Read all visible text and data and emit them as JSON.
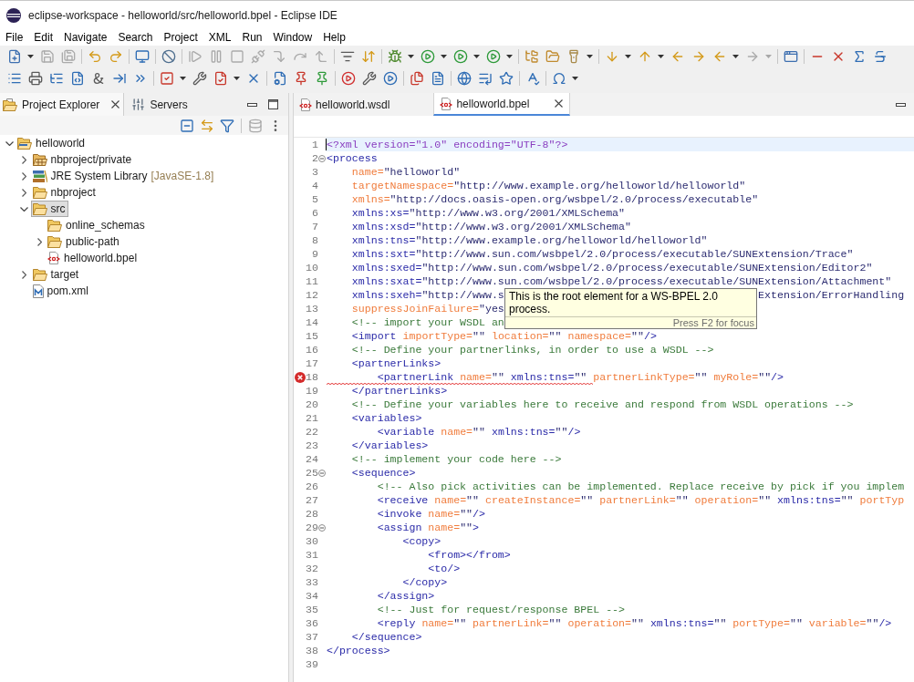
{
  "window": {
    "title": "eclipse-workspace - helloworld/src/helloworld.bpel - Eclipse IDE"
  },
  "menu": [
    "File",
    "Edit",
    "Navigate",
    "Search",
    "Project",
    "XML",
    "Run",
    "Window",
    "Help"
  ],
  "toolbar": [
    {
      "groups": [
        {
          "buttons": [
            {
              "disabled": false,
              "dropdown": true
            },
            {
              "disabled": true,
              "dropdown": false
            },
            {
              "disabled": true,
              "dropdown": false
            }
          ]
        },
        {
          "buttons": [
            {
              "disabled": false,
              "dropdown": false
            },
            {
              "disabled": false,
              "dropdown": false
            }
          ]
        },
        {
          "buttons": [
            {
              "disabled": false,
              "dropdown": false
            }
          ]
        },
        {
          "buttons": [
            {
              "disabled": false,
              "dropdown": false
            }
          ]
        },
        {
          "buttons": [
            {
              "disabled": true,
              "dropdown": false
            },
            {
              "disabled": true,
              "dropdown": false
            },
            {
              "disabled": true,
              "dropdown": false
            },
            {
              "disabled": true,
              "dropdown": false
            },
            {
              "disabled": true,
              "dropdown": false
            },
            {
              "disabled": true,
              "dropdown": false
            },
            {
              "disabled": true,
              "dropdown": false
            }
          ]
        },
        {
          "buttons": [
            {
              "disabled": false,
              "dropdown": false
            },
            {
              "disabled": false,
              "dropdown": false
            }
          ]
        },
        {
          "buttons": [
            {
              "disabled": false,
              "dropdown": true
            },
            {
              "disabled": false,
              "dropdown": true
            },
            {
              "disabled": false,
              "dropdown": true
            },
            {
              "disabled": false,
              "dropdown": true
            }
          ]
        },
        {
          "buttons": [
            {
              "disabled": false,
              "dropdown": false
            },
            {
              "disabled": false,
              "dropdown": false
            },
            {
              "disabled": false,
              "dropdown": true
            }
          ]
        },
        {
          "buttons": [
            {
              "disabled": false,
              "dropdown": true
            },
            {
              "disabled": false,
              "dropdown": true
            },
            {
              "disabled": false,
              "dropdown": false
            },
            {
              "disabled": false,
              "dropdown": false
            },
            {
              "disabled": false,
              "dropdown": true
            },
            {
              "disabled": true,
              "dropdown": true
            }
          ]
        },
        {
          "buttons": [
            {
              "disabled": false,
              "dropdown": false
            }
          ]
        },
        {
          "buttons": [
            {
              "disabled": false,
              "dropdown": false
            },
            {
              "disabled": false,
              "dropdown": false
            },
            {
              "disabled": false,
              "dropdown": false
            },
            {
              "disabled": false,
              "dropdown": false
            }
          ]
        }
      ]
    },
    {
      "groups": [
        {
          "buttons": [
            {
              "disabled": false,
              "dropdown": false
            },
            {
              "disabled": false,
              "dropdown": false
            },
            {
              "disabled": false,
              "dropdown": false
            },
            {
              "disabled": false,
              "dropdown": false
            },
            {
              "disabled": false,
              "dropdown": false
            },
            {
              "disabled": false,
              "dropdown": false
            },
            {
              "disabled": false,
              "dropdown": false
            }
          ]
        },
        {
          "buttons": [
            {
              "disabled": false,
              "dropdown": true
            },
            {
              "disabled": false,
              "dropdown": false
            },
            {
              "disabled": false,
              "dropdown": true
            },
            {
              "disabled": false,
              "dropdown": false
            }
          ]
        },
        {
          "buttons": [
            {
              "disabled": false,
              "dropdown": false
            },
            {
              "disabled": false,
              "dropdown": false
            },
            {
              "disabled": false,
              "dropdown": false
            }
          ]
        },
        {
          "buttons": [
            {
              "disabled": false,
              "dropdown": false
            },
            {
              "disabled": false,
              "dropdown": false
            },
            {
              "disabled": false,
              "dropdown": false
            }
          ]
        },
        {
          "buttons": [
            {
              "disabled": false,
              "dropdown": false
            },
            {
              "disabled": false,
              "dropdown": false
            }
          ]
        },
        {
          "buttons": [
            {
              "disabled": false,
              "dropdown": false
            },
            {
              "disabled": false,
              "dropdown": false
            },
            {
              "disabled": false,
              "dropdown": false
            }
          ]
        },
        {
          "buttons": [
            {
              "disabled": false,
              "dropdown": false
            }
          ]
        },
        {
          "buttons": [
            {
              "disabled": false,
              "dropdown": true
            }
          ]
        }
      ]
    }
  ],
  "project_explorer": {
    "tabs": [
      {
        "label": "Project Explorer",
        "selected": true
      },
      {
        "label": "Servers",
        "selected": false
      }
    ],
    "toolbar": [
      {
        "disabled": false
      },
      {
        "disabled": false
      },
      {
        "disabled": false
      },
      {
        "disabled": true
      },
      {
        "disabled": false
      }
    ],
    "tree": [
      {
        "label": "helloworld",
        "kind": "project",
        "expanded": true,
        "selected": false,
        "children": [
          {
            "label": "nbproject/private",
            "kind": "package",
            "expanded": false,
            "selected": false
          },
          {
            "label": "JRE System Library",
            "decoration": "[JavaSE-1.8]",
            "kind": "library",
            "expanded": false,
            "selected": false
          },
          {
            "label": "nbproject",
            "kind": "folder",
            "expanded": false,
            "selected": false
          },
          {
            "label": "src",
            "kind": "folder",
            "expanded": true,
            "selected": true,
            "children": [
              {
                "label": "online_schemas",
                "kind": "folder",
                "selected": false
              },
              {
                "label": "public-path",
                "kind": "folder",
                "expanded": false,
                "selected": false
              },
              {
                "label": "helloworld.bpel",
                "kind": "xml-file",
                "selected": false
              }
            ]
          },
          {
            "label": "target",
            "kind": "folder",
            "expanded": false,
            "selected": false
          },
          {
            "label": "pom.xml",
            "kind": "pom-file",
            "selected": false
          }
        ]
      }
    ]
  },
  "editor": {
    "tabs": [
      {
        "label": "helloworld.wsdl",
        "selected": false
      },
      {
        "label": "helloworld.bpel",
        "selected": true
      }
    ],
    "lines": [
      {
        "number": "1",
        "current": true,
        "error": false,
        "tokens": [
          {
            "kind": "pi",
            "text": "<?xml version=\"1.0\" encoding=\"UTF-8\"?>"
          }
        ]
      },
      {
        "number": "2",
        "current": false,
        "error": false,
        "expanded": true,
        "tokens": [
          {
            "kind": "tag",
            "text": "<process"
          }
        ]
      },
      {
        "number": "3",
        "current": false,
        "error": false,
        "tokens": [
          {
            "kind": "attr",
            "text": "    name="
          },
          {
            "kind": "value",
            "text": "\"helloworld\""
          }
        ]
      },
      {
        "number": "4",
        "current": false,
        "error": false,
        "tokens": [
          {
            "kind": "attr",
            "text": "    targetNamespace="
          },
          {
            "kind": "value",
            "text": "\"http://www.example.org/helloworld/helloworld\""
          }
        ]
      },
      {
        "number": "5",
        "current": false,
        "error": false,
        "tokens": [
          {
            "kind": "attr",
            "text": "    xmlns="
          },
          {
            "kind": "value",
            "text": "\"http://docs.oasis-open.org/wsbpel/2.0/process/executable\""
          }
        ]
      },
      {
        "number": "6",
        "current": false,
        "error": false,
        "tokens": [
          {
            "kind": "ns",
            "text": "    xmlns:xs="
          },
          {
            "kind": "value",
            "text": "\"http://www.w3.org/2001/XMLSchema\""
          }
        ]
      },
      {
        "number": "7",
        "current": false,
        "error": false,
        "tokens": [
          {
            "kind": "ns",
            "text": "    xmlns:xsd="
          },
          {
            "kind": "value",
            "text": "\"http://www.w3.org/2001/XMLSchema\""
          }
        ]
      },
      {
        "number": "8",
        "current": false,
        "error": false,
        "tokens": [
          {
            "kind": "ns",
            "text": "    xmlns:tns="
          },
          {
            "kind": "value",
            "text": "\"http://www.example.org/helloworld/helloworld\""
          }
        ]
      },
      {
        "number": "9",
        "current": false,
        "error": false,
        "tokens": [
          {
            "kind": "ns",
            "text": "    xmlns:sxt="
          },
          {
            "kind": "value",
            "text": "\"http://www.sun.com/wsbpel/2.0/process/executable/SUNExtension/Trace\""
          }
        ]
      },
      {
        "number": "10",
        "current": false,
        "error": false,
        "tokens": [
          {
            "kind": "ns",
            "text": "    xmlns:sxed="
          },
          {
            "kind": "value",
            "text": "\"http://www.sun.com/wsbpel/2.0/process/executable/SUNExtension/Editor2\""
          }
        ]
      },
      {
        "number": "11",
        "current": false,
        "error": false,
        "tokens": [
          {
            "kind": "ns",
            "text": "    xmlns:sxat="
          },
          {
            "kind": "value",
            "text": "\"http://www.sun.com/wsbpel/2.0/process/executable/SUNExtension/Attachment\""
          }
        ]
      },
      {
        "number": "12",
        "current": false,
        "error": false,
        "tokens": [
          {
            "kind": "ns",
            "text": "    xmlns:sxeh="
          },
          {
            "kind": "value",
            "text": "\"http://www.s"
          }
        ],
        "tokens_after_tooltip": [
          {
            "kind": "value",
            "text": "Extension/ErrorHandling"
          }
        ]
      },
      {
        "number": "13",
        "current": false,
        "error": false,
        "tokens": [
          {
            "kind": "attr",
            "text": "    suppressJoinFailure="
          },
          {
            "kind": "value",
            "text": "\"yes"
          }
        ]
      },
      {
        "number": "14",
        "current": false,
        "error": false,
        "tokens": [
          {
            "kind": "comment",
            "text": "    <!-- import your WSDL an"
          }
        ]
      },
      {
        "number": "15",
        "current": false,
        "error": false,
        "tokens": [
          {
            "kind": "tag",
            "text": "    <import"
          },
          {
            "kind": "attr",
            "text": " importType="
          },
          {
            "kind": "value",
            "text": "\"\""
          },
          {
            "kind": "attr",
            "text": " location="
          },
          {
            "kind": "value",
            "text": "\"\""
          },
          {
            "kind": "attr",
            "text": " namespace="
          },
          {
            "kind": "value",
            "text": "\"\""
          },
          {
            "kind": "tag",
            "text": "/>"
          }
        ]
      },
      {
        "number": "16",
        "current": false,
        "error": false,
        "tokens": [
          {
            "kind": "comment",
            "text": "    <!-- Define your partnerlinks, in order to use a WSDL -->"
          }
        ]
      },
      {
        "number": "17",
        "current": false,
        "error": false,
        "tokens": [
          {
            "kind": "tag",
            "text": "    <partnerLinks>"
          }
        ]
      },
      {
        "number": "18",
        "current": false,
        "error": true,
        "tokens": [
          {
            "kind": "tag",
            "text": "        <partnerLink"
          },
          {
            "kind": "attr",
            "text": " name="
          },
          {
            "kind": "value",
            "text": "\"\""
          },
          {
            "kind": "ns",
            "text": " xmlns:tns="
          },
          {
            "kind": "value",
            "text": "\"\""
          },
          {
            "kind": "attr",
            "text": " partnerLinkType="
          },
          {
            "kind": "value",
            "text": "\"\""
          },
          {
            "kind": "attr",
            "text": " myRole="
          },
          {
            "kind": "value",
            "text": "\"\""
          },
          {
            "kind": "tag",
            "text": "/>"
          }
        ]
      },
      {
        "number": "19",
        "current": false,
        "error": false,
        "tokens": [
          {
            "kind": "tag",
            "text": "    </partnerLinks>"
          }
        ]
      },
      {
        "number": "20",
        "current": false,
        "error": false,
        "tokens": [
          {
            "kind": "comment",
            "text": "    <!-- Define your variables here to receive and respond from WSDL operations -->"
          }
        ]
      },
      {
        "number": "21",
        "current": false,
        "error": false,
        "tokens": [
          {
            "kind": "tag",
            "text": "    <variables>"
          }
        ]
      },
      {
        "number": "22",
        "current": false,
        "error": false,
        "tokens": [
          {
            "kind": "tag",
            "text": "        <variable"
          },
          {
            "kind": "attr",
            "text": " name="
          },
          {
            "kind": "value",
            "text": "\"\""
          },
          {
            "kind": "ns",
            "text": " xmlns:tns="
          },
          {
            "kind": "value",
            "text": "\"\""
          },
          {
            "kind": "tag",
            "text": "/>"
          }
        ]
      },
      {
        "number": "23",
        "current": false,
        "error": false,
        "tokens": [
          {
            "kind": "tag",
            "text": "    </variables>"
          }
        ]
      },
      {
        "number": "24",
        "current": false,
        "error": false,
        "tokens": [
          {
            "kind": "comment",
            "text": "    <!-- implement your code here -->"
          }
        ]
      },
      {
        "number": "25",
        "current": false,
        "error": false,
        "expanded": true,
        "tokens": [
          {
            "kind": "tag",
            "text": "    <sequence>"
          }
        ]
      },
      {
        "number": "26",
        "current": false,
        "error": false,
        "tokens": [
          {
            "kind": "comment",
            "text": "        <!-- Also pick activities can be implemented. Replace receive by pick if you implem"
          }
        ]
      },
      {
        "number": "27",
        "current": false,
        "error": false,
        "tokens": [
          {
            "kind": "tag",
            "text": "        <receive"
          },
          {
            "kind": "attr",
            "text": " name="
          },
          {
            "kind": "value",
            "text": "\"\""
          },
          {
            "kind": "attr",
            "text": " createInstance="
          },
          {
            "kind": "value",
            "text": "\"\""
          },
          {
            "kind": "attr",
            "text": " partnerLink="
          },
          {
            "kind": "value",
            "text": "\"\""
          },
          {
            "kind": "attr",
            "text": " operation="
          },
          {
            "kind": "value",
            "text": "\"\""
          },
          {
            "kind": "ns",
            "text": " xmlns:tns="
          },
          {
            "kind": "value",
            "text": "\"\""
          },
          {
            "kind": "attr",
            "text": " portTyp"
          }
        ]
      },
      {
        "number": "28",
        "current": false,
        "error": false,
        "tokens": [
          {
            "kind": "tag",
            "text": "        <invoke"
          },
          {
            "kind": "attr",
            "text": " name="
          },
          {
            "kind": "value",
            "text": "\"\""
          },
          {
            "kind": "tag",
            "text": "/>"
          }
        ]
      },
      {
        "number": "29",
        "current": false,
        "error": false,
        "expanded": true,
        "tokens": [
          {
            "kind": "tag",
            "text": "        <assign"
          },
          {
            "kind": "attr",
            "text": " name="
          },
          {
            "kind": "value",
            "text": "\"\""
          },
          {
            "kind": "tag",
            "text": ">"
          }
        ]
      },
      {
        "number": "30",
        "current": false,
        "error": false,
        "tokens": [
          {
            "kind": "tag",
            "text": "            <copy>"
          }
        ]
      },
      {
        "number": "31",
        "current": false,
        "error": false,
        "tokens": [
          {
            "kind": "tag",
            "text": "                <from></from>"
          }
        ]
      },
      {
        "number": "32",
        "current": false,
        "error": false,
        "tokens": [
          {
            "kind": "tag",
            "text": "                <to/>"
          }
        ]
      },
      {
        "number": "33",
        "current": false,
        "error": false,
        "tokens": [
          {
            "kind": "tag",
            "text": "            </copy>"
          }
        ]
      },
      {
        "number": "34",
        "current": false,
        "error": false,
        "tokens": [
          {
            "kind": "tag",
            "text": "        </assign>"
          }
        ]
      },
      {
        "number": "35",
        "current": false,
        "error": false,
        "tokens": [
          {
            "kind": "comment",
            "text": "        <!-- Just for request/response BPEL -->"
          }
        ]
      },
      {
        "number": "36",
        "current": false,
        "error": false,
        "tokens": [
          {
            "kind": "tag",
            "text": "        <reply"
          },
          {
            "kind": "attr",
            "text": " name="
          },
          {
            "kind": "value",
            "text": "\"\""
          },
          {
            "kind": "attr",
            "text": " partnerLink="
          },
          {
            "kind": "value",
            "text": "\"\""
          },
          {
            "kind": "attr",
            "text": " operation="
          },
          {
            "kind": "value",
            "text": "\"\""
          },
          {
            "kind": "ns",
            "text": " xmlns:tns="
          },
          {
            "kind": "value",
            "text": "\"\""
          },
          {
            "kind": "attr",
            "text": " portType="
          },
          {
            "kind": "value",
            "text": "\"\""
          },
          {
            "kind": "attr",
            "text": " variable="
          },
          {
            "kind": "value",
            "text": "\"\""
          },
          {
            "kind": "tag",
            "text": "/>"
          }
        ]
      },
      {
        "number": "37",
        "current": false,
        "error": false,
        "tokens": [
          {
            "kind": "tag",
            "text": "    </sequence>"
          }
        ]
      },
      {
        "number": "38",
        "current": false,
        "error": false,
        "tokens": [
          {
            "kind": "tag",
            "text": "</process>"
          }
        ]
      },
      {
        "number": "39",
        "current": false,
        "error": false
      }
    ],
    "tooltip": {
      "text": "This is the root element for a WS-BPEL 2.0 process.",
      "footer": "Press F2 for focus"
    }
  }
}
